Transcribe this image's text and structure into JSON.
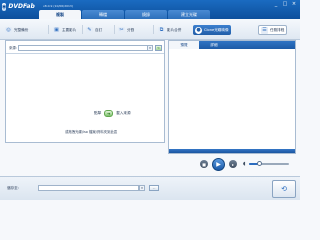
{
  "app": {
    "logo_text": "DVDFab",
    "version": "v8.0.9 (10/06/2013)"
  },
  "window_controls": [
    "_",
    "□",
    "×"
  ],
  "main_tabs": [
    {
      "label": "複製",
      "active": true
    },
    {
      "label": "轉檔",
      "active": false
    },
    {
      "label": "燒錄",
      "active": false
    },
    {
      "label": "建立光碟",
      "active": false
    }
  ],
  "toolbar": {
    "items": [
      {
        "label": "完整備份",
        "icon": "disc-copy-icon"
      },
      {
        "label": "主要影片",
        "icon": "film-icon"
      },
      {
        "label": "自訂",
        "icon": "custom-icon"
      },
      {
        "label": "分割",
        "icon": "split-icon"
      },
      {
        "label": "影片合併",
        "icon": "merge-icon"
      },
      {
        "label": "Clone光碟映像",
        "icon": "clone-icon"
      },
      {
        "label": "任務排程",
        "icon": "task-queue-icon"
      }
    ]
  },
  "source": {
    "label": "來源:",
    "value": "",
    "go_label": "↻"
  },
  "hints": {
    "prefix": "點擊",
    "open_label": "載入來源",
    "secondary": "或拖拽光碟/iso 檔案/資料夾到此區"
  },
  "preview_tabs": [
    {
      "label": "預覽",
      "active": true
    },
    {
      "label": "詳細",
      "active": false
    }
  ],
  "playback": {
    "progress": 0,
    "volume": 0.25
  },
  "output": {
    "label": "儲存至:",
    "value": "",
    "browse_label": "..."
  },
  "colors": {
    "brand": "#1a6bc1",
    "accent": "#2b6cbf",
    "open_green": "#7cc16a"
  }
}
